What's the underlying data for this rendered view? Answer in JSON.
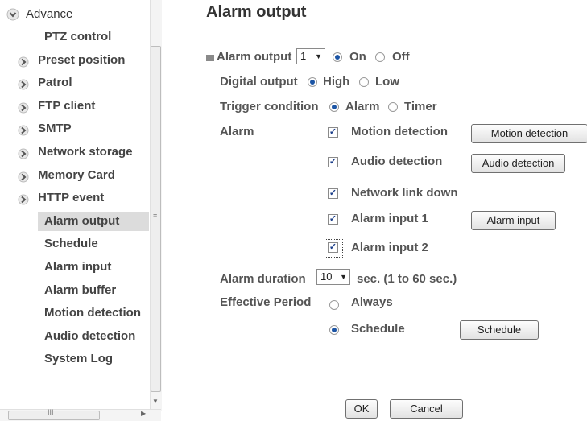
{
  "sidebar": {
    "group_label": "Advance",
    "items": [
      {
        "label": "PTZ control",
        "icon": "none"
      },
      {
        "label": "Preset position",
        "icon": "chevron-right-icon"
      },
      {
        "label": "Patrol",
        "icon": "chevron-right-icon"
      },
      {
        "label": "FTP client",
        "icon": "chevron-right-icon"
      },
      {
        "label": "SMTP",
        "icon": "chevron-right-icon"
      },
      {
        "label": "Network storage",
        "icon": "chevron-right-icon"
      },
      {
        "label": "Memory Card",
        "icon": "chevron-right-icon"
      },
      {
        "label": "HTTP event",
        "icon": "chevron-right-icon"
      },
      {
        "label": "Alarm output",
        "icon": "none",
        "selected": true
      },
      {
        "label": "Schedule",
        "icon": "none"
      },
      {
        "label": "Alarm input",
        "icon": "none"
      },
      {
        "label": "Alarm buffer",
        "icon": "none"
      },
      {
        "label": "Motion detection",
        "icon": "none"
      },
      {
        "label": "Audio detection",
        "icon": "none"
      },
      {
        "label": "System Log",
        "icon": "none"
      }
    ]
  },
  "page": {
    "title": "Alarm output"
  },
  "form": {
    "alarm_output_label": "Alarm output",
    "alarm_output_value": "1",
    "on_label": "On",
    "off_label": "Off",
    "digital_output_label": "Digital output",
    "high_label": "High",
    "low_label": "Low",
    "trigger_label": "Trigger condition",
    "trigger_alarm_label": "Alarm",
    "trigger_timer_label": "Timer",
    "alarm_label": "Alarm",
    "motion_label": "Motion detection",
    "audio_label": "Audio detection",
    "network_label": "Network link down",
    "alarm_input1_label": "Alarm input 1",
    "alarm_input2_label": "Alarm input 2",
    "motion_button": "Motion detection",
    "audio_button": "Audio detection",
    "alarm_input_button": "Alarm input",
    "duration_label": "Alarm duration",
    "duration_value": "10",
    "duration_hint": "sec. (1 to 60 sec.)",
    "period_label": "Effective Period",
    "always_label": "Always",
    "schedule_label": "Schedule",
    "schedule_button": "Schedule",
    "check_mark": "✓"
  },
  "buttons": {
    "ok": "OK",
    "cancel": "Cancel"
  },
  "colors": {
    "selected_bg": "#dcdcdc",
    "radio_dot": "#1c55a5"
  }
}
